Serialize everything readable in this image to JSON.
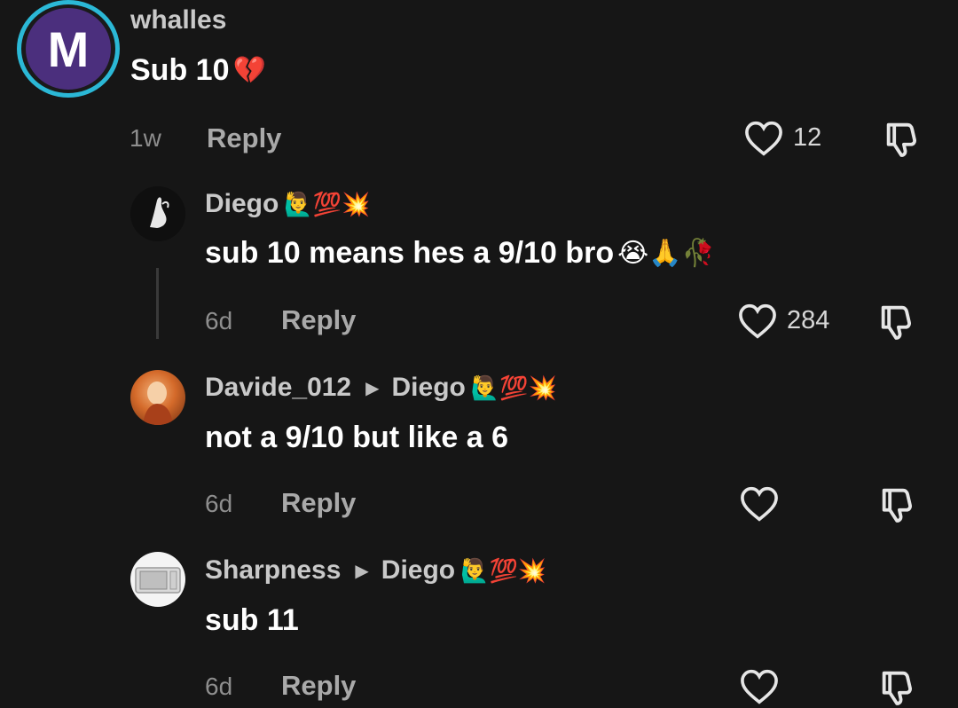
{
  "comments": [
    {
      "avatar_letter": "M",
      "username": "whalles",
      "text": "Sub 10",
      "text_emoji": "💔",
      "time": "1w",
      "reply_label": "Reply",
      "likes": "12"
    },
    {
      "username": "Diego",
      "username_emoji": "🙋‍♂️💯💥",
      "text": "sub 10 means hes a 9/10 bro",
      "text_emoji": "😭🙏🥀",
      "time": "6d",
      "reply_label": "Reply",
      "likes": "284"
    },
    {
      "username": "Davide_012",
      "reply_to": "Diego",
      "reply_to_emoji": "🙋‍♂️💯💥",
      "text": "not a 9/10 but like a 6",
      "time": "6d",
      "reply_label": "Reply",
      "likes": ""
    },
    {
      "username": "Sharpness",
      "reply_to": "Diego",
      "reply_to_emoji": "🙋‍♂️💯💥",
      "text": "sub 11",
      "time": "6d",
      "reply_label": "Reply",
      "likes": ""
    }
  ],
  "icons": {
    "like": "heart-icon",
    "dislike": "thumbs-down-icon",
    "reply_arrow": "play-arrow-icon"
  },
  "colors": {
    "background": "#161616",
    "avatar_ring": "#2bb8d6",
    "avatar_fill": "#4b2f7d"
  }
}
